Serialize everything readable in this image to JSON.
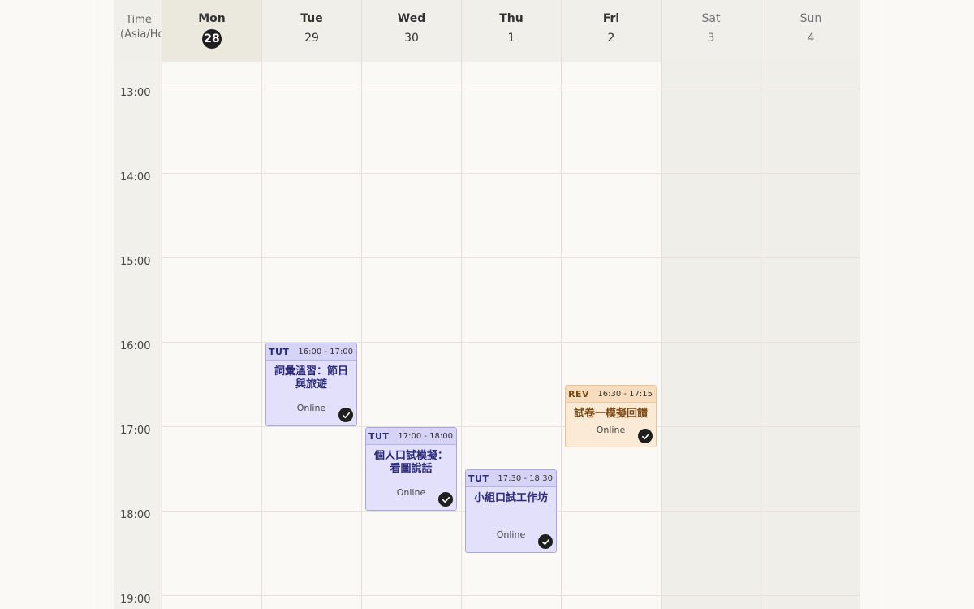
{
  "time_header": {
    "line1": "Time",
    "line2": "(Asia/Hong_Kong)"
  },
  "days": [
    {
      "name": "Mon",
      "num": "28",
      "today": true,
      "weekend": false
    },
    {
      "name": "Tue",
      "num": "29",
      "today": false,
      "weekend": false
    },
    {
      "name": "Wed",
      "num": "30",
      "today": false,
      "weekend": false
    },
    {
      "name": "Thu",
      "num": "1",
      "today": false,
      "weekend": false
    },
    {
      "name": "Fri",
      "num": "2",
      "today": false,
      "weekend": false
    },
    {
      "name": "Sat",
      "num": "3",
      "today": false,
      "weekend": true
    },
    {
      "name": "Sun",
      "num": "4",
      "today": false,
      "weekend": true
    }
  ],
  "hours": [
    "13:00",
    "14:00",
    "15:00",
    "16:00",
    "17:00",
    "18:00",
    "19:00"
  ],
  "events": [
    {
      "day": 1,
      "start": "16:00",
      "end": "17:00",
      "type": "TUT",
      "time_label": "16:00 - 17:00",
      "title": "詞彙溫習：節日與旅遊",
      "location": "Online",
      "completed": true
    },
    {
      "day": 2,
      "start": "17:00",
      "end": "18:00",
      "type": "TUT",
      "time_label": "17:00 - 18:00",
      "title": "個人口試模擬：看圖說話",
      "location": "Online",
      "completed": true
    },
    {
      "day": 3,
      "start": "17:30",
      "end": "18:30",
      "type": "TUT",
      "time_label": "17:30 - 18:30",
      "title": "小組口試工作坊",
      "location": "Online",
      "completed": true
    },
    {
      "day": 4,
      "start": "16:30",
      "end": "17:15",
      "type": "REV",
      "time_label": "16:30 - 17:15",
      "title": "試卷一模擬回饋",
      "location": "Online",
      "completed": true
    }
  ],
  "colors": {
    "tut_bg": "#e2e0fb",
    "rev_bg": "#fbead6",
    "today_badge": "#1f1f1f"
  }
}
